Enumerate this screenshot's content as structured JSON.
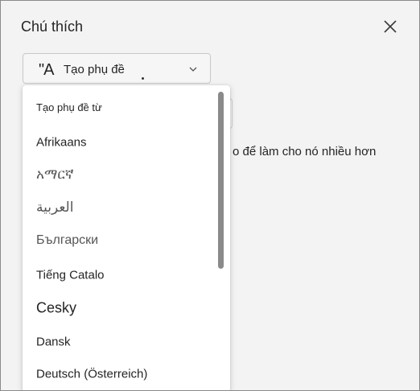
{
  "panel": {
    "title": "Chú thích",
    "close_icon": "close-icon"
  },
  "dropdown": {
    "icon_text": "\"A",
    "label": "Tạo phụ đề"
  },
  "background": {
    "text": "o để làm cho nó nhiều hơn"
  },
  "menu": {
    "header": "Tạo phụ đề từ",
    "items": [
      {
        "label": "Afrikaans"
      },
      {
        "label": "አማርኛ"
      },
      {
        "label": "العربية"
      },
      {
        "label": "Български"
      },
      {
        "label": "Tiếng Catalo"
      },
      {
        "label": "Cesky"
      },
      {
        "label": "Dansk"
      },
      {
        "label": "Deutsch (Österreich)"
      }
    ]
  },
  "colors": {
    "panel_bg": "#f3f3f3",
    "menu_bg": "#ffffff",
    "text": "#242424",
    "scrollbar": "#8a8a8a"
  }
}
